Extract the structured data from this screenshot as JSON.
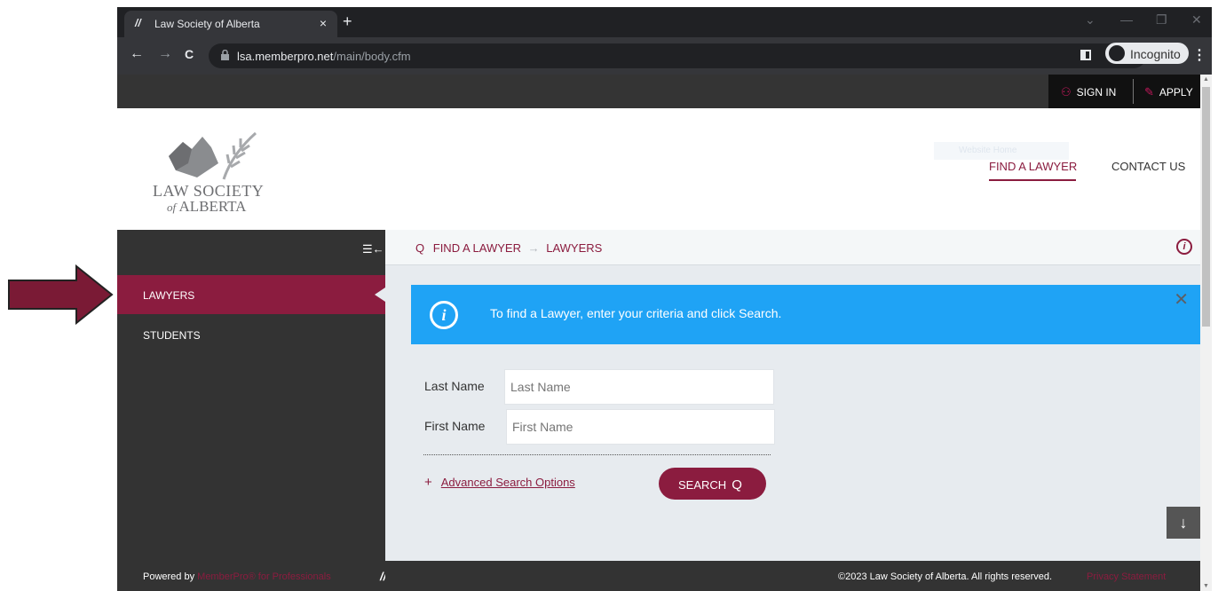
{
  "browser": {
    "tab_title": "Law Society of Alberta",
    "tab_close": "×",
    "new_tab": "+",
    "url_host": "lsa.memberpro.net",
    "url_path": "/main/body.cfm",
    "incognito_label": "Incognito",
    "back": "←",
    "forward": "→",
    "reload": "C",
    "star": "☆",
    "menu": "⋮",
    "win_min": "—",
    "win_restore": "❐",
    "win_close": "✕",
    "tab_search": "⌄"
  },
  "topbar": {
    "sign_in": "SIGN IN",
    "apply": "APPLY"
  },
  "header": {
    "logo_line1": "LAW SOCIETY",
    "logo_of": "of",
    "logo_line2": "ALBERTA",
    "ghost_button": "Website Home",
    "nav": [
      {
        "label": "FIND A LAWYER",
        "active": true
      },
      {
        "label": "CONTACT US",
        "active": false
      }
    ]
  },
  "sidebar": {
    "collapse_glyph": "☰←",
    "items": [
      {
        "label": "LAWYERS",
        "active": true
      },
      {
        "label": "STUDENTS",
        "active": false
      }
    ]
  },
  "breadcrumb": {
    "search_glyph": "Q",
    "items": [
      "FIND A LAWYER",
      "LAWYERS"
    ],
    "separator": "→",
    "info_glyph": "i"
  },
  "alert": {
    "icon_glyph": "i",
    "message": "To find a Lawyer, enter your criteria and click Search.",
    "close": "✕"
  },
  "form": {
    "last_name_label": "Last Name",
    "last_name_placeholder": "Last Name",
    "first_name_label": "First Name",
    "first_name_placeholder": "First Name",
    "advanced_plus": "+",
    "advanced_label": "Advanced Search Options",
    "search_label": "SEARCH",
    "search_glyph": "Q",
    "down_glyph": "↓"
  },
  "footer": {
    "powered_by": "Powered by",
    "powered_link": "MemberPro® for Professionals",
    "copyright": "©2023 Law Society of Alberta. All rights reserved.",
    "privacy": "Privacy Statement"
  },
  "colors": {
    "brand": "#8b1c3f",
    "alert_blue": "#1fa3f5",
    "sidebar": "#333333",
    "annotation_arrow": "#7a1a35"
  }
}
